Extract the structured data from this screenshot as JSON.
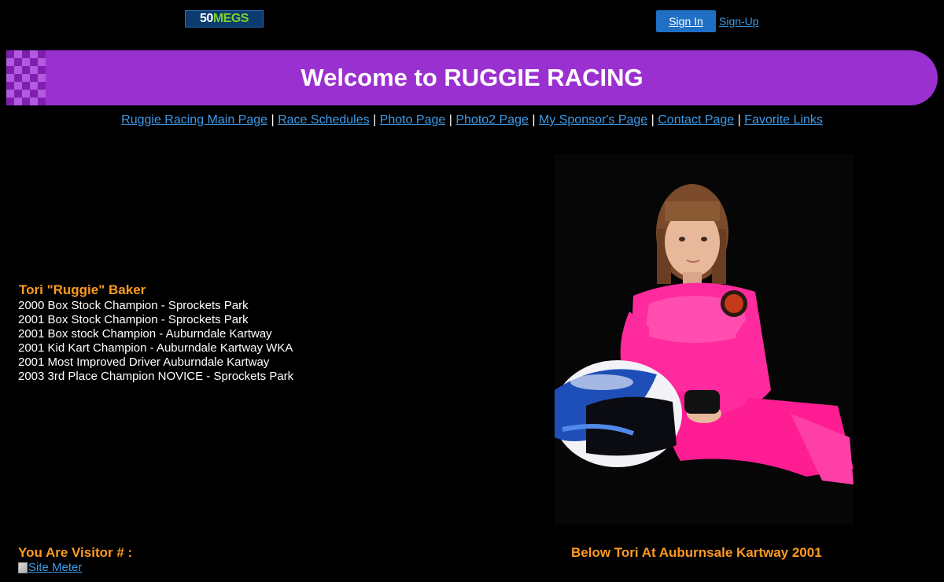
{
  "header": {
    "logo": {
      "num": "50",
      "text": "MEGS",
      "icon": "50megs-logo"
    },
    "signin_label": "Sign In",
    "signup_label": "Sign-Up"
  },
  "banner": {
    "title": "Welcome to RUGGIE RACING",
    "color": "#9b30d0"
  },
  "nav": {
    "links": [
      "Ruggie Racing Main Page",
      "Race Schedules",
      "Photo Page",
      "Photo2 Page",
      "My Sponsor's Page",
      "Contact Page",
      "Favorite Links"
    ],
    "separator": "|"
  },
  "driver": {
    "name": "Tori \"Ruggie\" Baker",
    "achievements": [
      "2000 Box Stock Champion - Sprockets Park",
      "2001 Box Stock Champion - Sprockets Park",
      "2001 Box stock Champion - Auburndale Kartway",
      "2001 Kid Kart Champion - Auburndale Kartway WKA",
      "2001 Most Improved Driver Auburndale Kartway",
      "2003 3rd Place Champion NOVICE - Sprockets Park"
    ]
  },
  "footer": {
    "visitor_label": "You Are Visitor # :",
    "sitemeter_alt": "Site Meter",
    "photo_caption": "Below Tori At Auburnsale Kartway 2001"
  },
  "colors": {
    "accent_orange": "#ff9a1f",
    "link_blue": "#3d9be9",
    "button_blue": "#1f6fc4"
  }
}
